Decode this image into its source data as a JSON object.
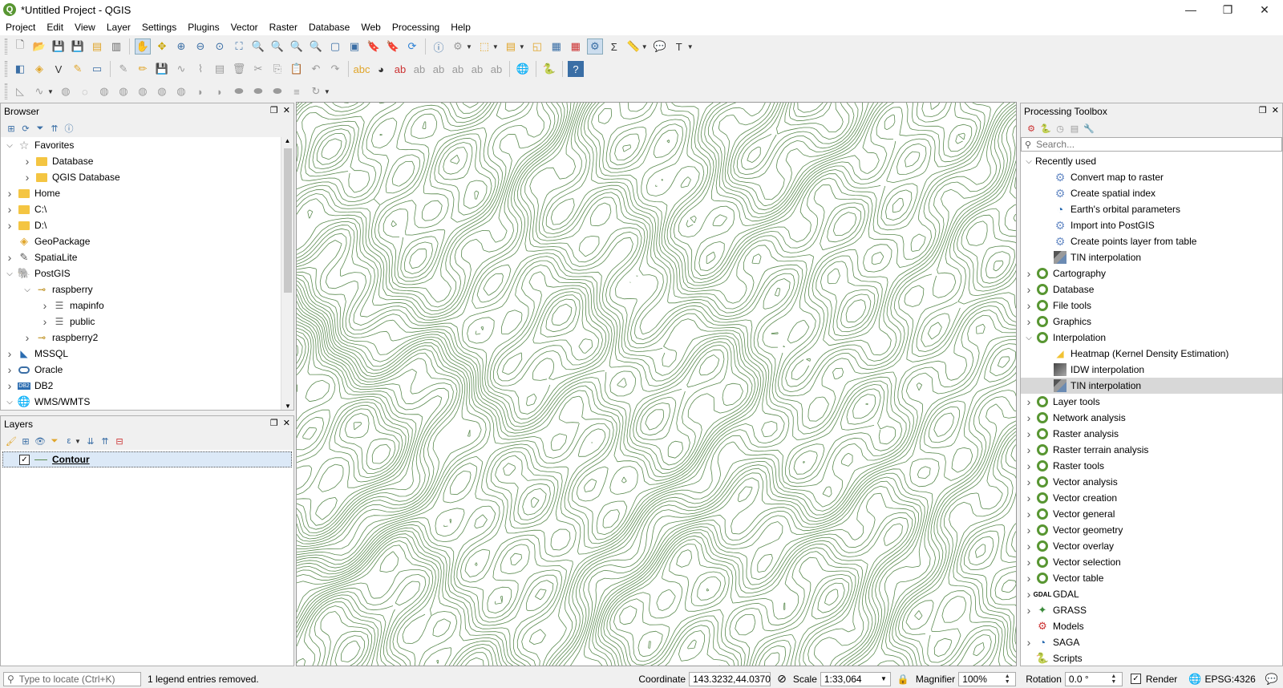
{
  "window": {
    "title": "*Untitled Project - QGIS",
    "logo": "Q",
    "controls": [
      "—",
      "❐",
      "✕"
    ]
  },
  "menu": [
    "Project",
    "Edit",
    "View",
    "Layer",
    "Settings",
    "Plugins",
    "Vector",
    "Raster",
    "Database",
    "Web",
    "Processing",
    "Help"
  ],
  "browser": {
    "title": "Browser",
    "items": [
      {
        "label": "Favorites",
        "indent": 0,
        "arrow": "v",
        "icon": "star-icon"
      },
      {
        "label": "Database",
        "indent": 1,
        "arrow": ">",
        "icon": "folder-icon"
      },
      {
        "label": "QGIS Database",
        "indent": 1,
        "arrow": ">",
        "icon": "folder-icon"
      },
      {
        "label": "Home",
        "indent": 0,
        "arrow": ">",
        "icon": "folder-icon"
      },
      {
        "label": "C:\\",
        "indent": 0,
        "arrow": ">",
        "icon": "folder-icon"
      },
      {
        "label": "D:\\",
        "indent": 0,
        "arrow": ">",
        "icon": "folder-icon"
      },
      {
        "label": "GeoPackage",
        "indent": 0,
        "arrow": "",
        "icon": "geopackage-icon"
      },
      {
        "label": "SpatiaLite",
        "indent": 0,
        "arrow": ">",
        "icon": "spatialite-icon"
      },
      {
        "label": "PostGIS",
        "indent": 0,
        "arrow": "v",
        "icon": "postgis-icon"
      },
      {
        "label": "raspberry",
        "indent": 1,
        "arrow": "v",
        "icon": "connection-icon"
      },
      {
        "label": "mapinfo",
        "indent": 2,
        "arrow": ">",
        "icon": "schema-icon"
      },
      {
        "label": "public",
        "indent": 2,
        "arrow": ">",
        "icon": "schema-icon"
      },
      {
        "label": "raspberry2",
        "indent": 1,
        "arrow": ">",
        "icon": "connection-icon"
      },
      {
        "label": "MSSQL",
        "indent": 0,
        "arrow": ">",
        "icon": "mssql-icon"
      },
      {
        "label": "Oracle",
        "indent": 0,
        "arrow": ">",
        "icon": "oracle-icon"
      },
      {
        "label": "DB2",
        "indent": 0,
        "arrow": ">",
        "icon": "db2-icon"
      },
      {
        "label": "WMS/WMTS",
        "indent": 0,
        "arrow": "v",
        "icon": "wms-icon"
      }
    ]
  },
  "layers": {
    "title": "Layers",
    "items": [
      {
        "label": "Contour",
        "checked": true
      }
    ]
  },
  "toolbox": {
    "title": "Processing Toolbox",
    "search_placeholder": "Search...",
    "items": [
      {
        "label": "Recently used",
        "indent": 0,
        "arrow": "v",
        "icon": ""
      },
      {
        "label": "Convert map to raster",
        "indent": 1,
        "arrow": "",
        "icon": "gear-icon"
      },
      {
        "label": "Create spatial index",
        "indent": 1,
        "arrow": "",
        "icon": "gear-icon"
      },
      {
        "label": "Earth's orbital parameters",
        "indent": 1,
        "arrow": "",
        "icon": "saga-icon"
      },
      {
        "label": "Import into PostGIS",
        "indent": 1,
        "arrow": "",
        "icon": "gear-icon"
      },
      {
        "label": "Create points layer from table",
        "indent": 1,
        "arrow": "",
        "icon": "gear-icon"
      },
      {
        "label": "TIN interpolation",
        "indent": 1,
        "arrow": "",
        "icon": "tin-icon"
      },
      {
        "label": "Cartography",
        "indent": 0,
        "arrow": ">",
        "icon": "qgis-icon"
      },
      {
        "label": "Database",
        "indent": 0,
        "arrow": ">",
        "icon": "qgis-icon"
      },
      {
        "label": "File tools",
        "indent": 0,
        "arrow": ">",
        "icon": "qgis-icon"
      },
      {
        "label": "Graphics",
        "indent": 0,
        "arrow": ">",
        "icon": "qgis-icon"
      },
      {
        "label": "Interpolation",
        "indent": 0,
        "arrow": "v",
        "icon": "qgis-icon"
      },
      {
        "label": "Heatmap (Kernel Density Estimation)",
        "indent": 1,
        "arrow": "",
        "icon": "heatmap-icon"
      },
      {
        "label": "IDW interpolation",
        "indent": 1,
        "arrow": "",
        "icon": "idw-icon"
      },
      {
        "label": "TIN interpolation",
        "indent": 1,
        "arrow": "",
        "icon": "tin-icon",
        "selected": true
      },
      {
        "label": "Layer tools",
        "indent": 0,
        "arrow": ">",
        "icon": "qgis-icon"
      },
      {
        "label": "Network analysis",
        "indent": 0,
        "arrow": ">",
        "icon": "qgis-icon"
      },
      {
        "label": "Raster analysis",
        "indent": 0,
        "arrow": ">",
        "icon": "qgis-icon"
      },
      {
        "label": "Raster terrain analysis",
        "indent": 0,
        "arrow": ">",
        "icon": "qgis-icon"
      },
      {
        "label": "Raster tools",
        "indent": 0,
        "arrow": ">",
        "icon": "qgis-icon"
      },
      {
        "label": "Vector analysis",
        "indent": 0,
        "arrow": ">",
        "icon": "qgis-icon"
      },
      {
        "label": "Vector creation",
        "indent": 0,
        "arrow": ">",
        "icon": "qgis-icon"
      },
      {
        "label": "Vector general",
        "indent": 0,
        "arrow": ">",
        "icon": "qgis-icon"
      },
      {
        "label": "Vector geometry",
        "indent": 0,
        "arrow": ">",
        "icon": "qgis-icon"
      },
      {
        "label": "Vector overlay",
        "indent": 0,
        "arrow": ">",
        "icon": "qgis-icon"
      },
      {
        "label": "Vector selection",
        "indent": 0,
        "arrow": ">",
        "icon": "qgis-icon"
      },
      {
        "label": "Vector table",
        "indent": 0,
        "arrow": ">",
        "icon": "qgis-icon"
      },
      {
        "label": "GDAL",
        "indent": 0,
        "arrow": ">",
        "icon": "gdal-icon"
      },
      {
        "label": "GRASS",
        "indent": 0,
        "arrow": ">",
        "icon": "grass-icon"
      },
      {
        "label": "Models",
        "indent": 0,
        "arrow": "",
        "icon": "models-icon"
      },
      {
        "label": "SAGA",
        "indent": 0,
        "arrow": ">",
        "icon": "saga-icon"
      },
      {
        "label": "Scripts",
        "indent": 0,
        "arrow": "",
        "icon": "python-icon"
      }
    ]
  },
  "map": {
    "contour_color": "#5a8a4f",
    "background": "#ffffff"
  },
  "status": {
    "locate_placeholder": "Type to locate (Ctrl+K)",
    "message": "1 legend entries removed.",
    "coordinate_label": "Coordinate",
    "coordinate_value": "143.3232,44.0370",
    "scale_label": "Scale",
    "scale_value": "1:33,064",
    "magnifier_label": "Magnifier",
    "magnifier_value": "100%",
    "rotation_label": "Rotation",
    "rotation_value": "0.0 °",
    "render_label": "Render",
    "crs_value": "EPSG:4326"
  }
}
